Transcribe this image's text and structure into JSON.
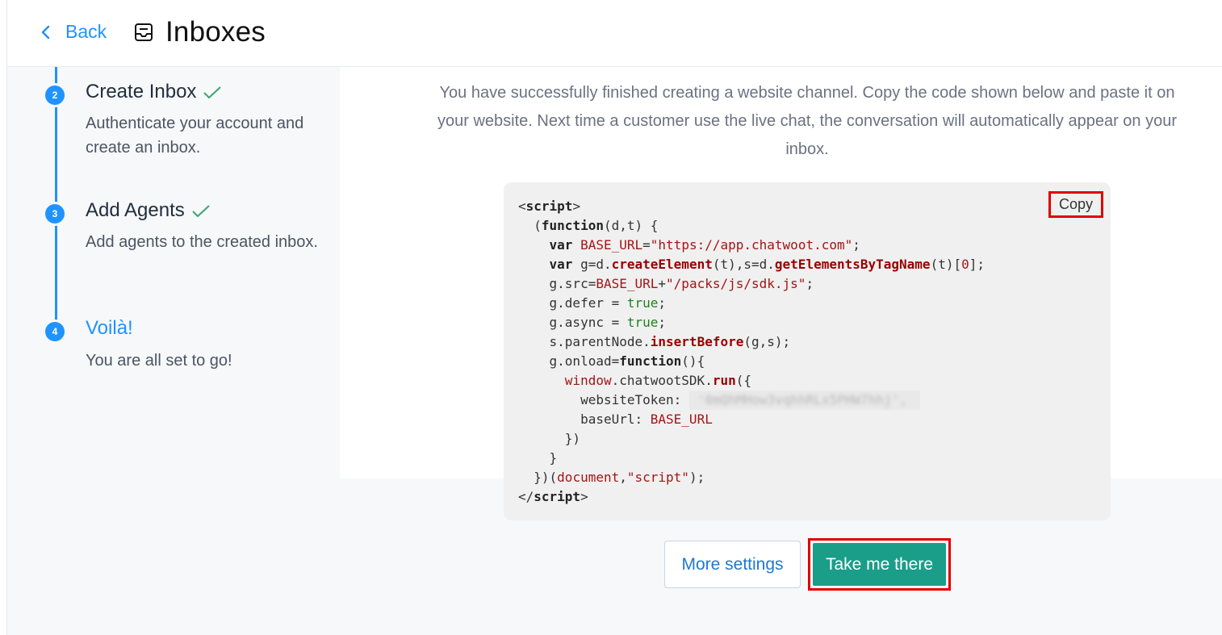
{
  "header": {
    "back_label": "Back",
    "title": "Inboxes"
  },
  "steps": [
    {
      "number": "2",
      "title": "Create Inbox",
      "description": "Authenticate your account and create an inbox.",
      "done": true
    },
    {
      "number": "3",
      "title": "Add Agents",
      "description": "Add agents to the created inbox.",
      "done": true
    },
    {
      "number": "4",
      "title": "Voilà!",
      "description": "You are all set to go!",
      "done": false
    }
  ],
  "main": {
    "intro": "You have successfully finished creating a website channel. Copy the code shown below and paste it on your website. Next time a customer use the live chat, the conversation will automatically appear on your inbox.",
    "copy_label": "Copy",
    "more_settings_label": "More settings",
    "take_me_there_label": "Take me there"
  },
  "code": {
    "base_url": "https://app.chatwoot.com",
    "sdk_path": "/packs/js/sdk.js",
    "script_tag": "script"
  },
  "colors": {
    "primary": "#1f93ff",
    "success_button": "#1a9e8a",
    "highlight_border": "#e00000",
    "check_green": "#3aa36f"
  }
}
